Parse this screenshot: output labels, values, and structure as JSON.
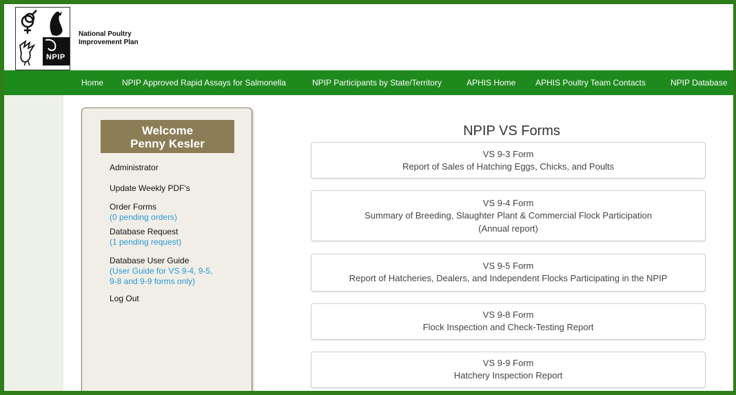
{
  "header": {
    "org_line1": "National Poultry",
    "org_line2": "Improvement Plan",
    "logo_text": "NPIP",
    "logo_caption": "NATIONAL POULTRY IMPROVEMENT PLAN"
  },
  "nav": {
    "items": [
      "Home",
      "NPIP Approved Rapid Assays for Salmonella",
      "NPIP Participants by State/Territory",
      "APHIS Home",
      "APHIS Poultry Team Contacts",
      "NPIP Database"
    ]
  },
  "sidebar": {
    "welcome": "Welcome",
    "user_name": "Penny Kesler",
    "administrator": "Administrator",
    "update_weekly": "Update Weekly PDF's",
    "order_forms": "Order Forms",
    "order_forms_sub": "(0 pending orders)",
    "db_request": "Database Request",
    "db_request_sub": "(1 pending request)",
    "user_guide": "Database User Guide",
    "user_guide_sub1": "(User Guide for VS 9-4, 9-5,",
    "user_guide_sub2": "9-8 and 9-9 forms only)",
    "logout": "Log Out"
  },
  "main": {
    "title": "NPIP VS Forms",
    "forms": [
      {
        "name": "VS 9-3 Form",
        "desc": "Report of Sales of Hatching Eggs, Chicks, and Poults",
        "desc2": ""
      },
      {
        "name": "VS 9-4 Form",
        "desc": "Summary of Breeding, Slaughter Plant & Commercial Flock Participation",
        "desc2": "(Annual report)"
      },
      {
        "name": "VS 9-5 Form",
        "desc": "Report of Hatcheries, Dealers, and Independent Flocks Participating in the NPIP",
        "desc2": ""
      },
      {
        "name": "VS 9-8 Form",
        "desc": "Flock Inspection and Check-Testing Report",
        "desc2": ""
      },
      {
        "name": "VS 9-9 Form",
        "desc": "Hatchery Inspection Report",
        "desc2": ""
      }
    ]
  },
  "colors": {
    "nav_green": "#1e8a1e",
    "frame_green": "#2e7d1a",
    "welcome_bg": "#8b7d56",
    "link_blue": "#2a9ad8"
  }
}
